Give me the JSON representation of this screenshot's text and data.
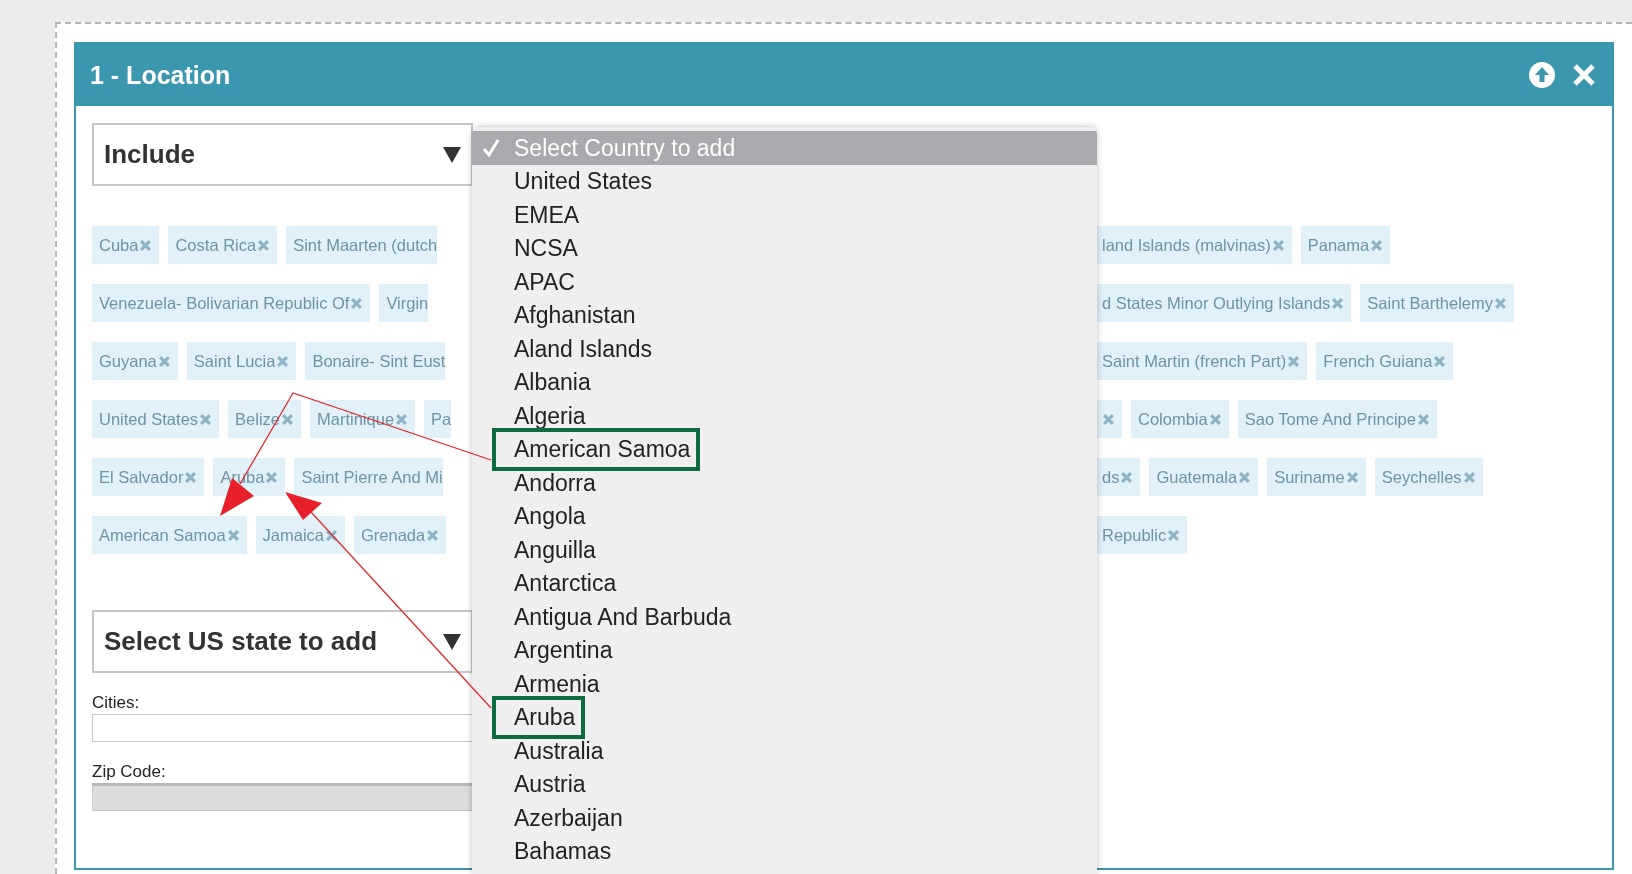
{
  "panel": {
    "title": "1 - Location"
  },
  "mode_select": {
    "value": "Include"
  },
  "tag_rows": [
    {
      "left": [
        {
          "label": "Cuba",
          "close": true
        },
        {
          "label": "Costa Rica",
          "close": true
        },
        {
          "label": "Sint Maarten (dutch",
          "close": false
        }
      ],
      "right": [
        {
          "label": "land Islands (malvinas)",
          "close": true
        },
        {
          "label": "Panama",
          "close": true
        }
      ]
    },
    {
      "left": [
        {
          "label": "Venezuela- Bolivarian Republic Of",
          "close": true
        },
        {
          "label": "Virgin",
          "close": false
        }
      ],
      "right": [
        {
          "label": "d States Minor Outlying Islands",
          "close": true
        },
        {
          "label": "Saint Barthelemy",
          "close": true
        }
      ]
    },
    {
      "left": [
        {
          "label": "Guyana",
          "close": true
        },
        {
          "label": "Saint Lucia",
          "close": true
        },
        {
          "label": "Bonaire- Sint Eust",
          "close": false
        }
      ],
      "right": [
        {
          "label": "Saint Martin (french Part)",
          "close": true
        },
        {
          "label": "French Guiana",
          "close": true
        }
      ]
    },
    {
      "left": [
        {
          "label": "United States",
          "close": true
        },
        {
          "label": "Belize",
          "close": true
        },
        {
          "label": "Martinique",
          "close": true
        },
        {
          "label": "Pa",
          "close": false
        }
      ],
      "right": [
        {
          "close": true
        },
        {
          "label": "Colombia",
          "close": true
        },
        {
          "label": "Sao Tome And Principe",
          "close": true
        }
      ]
    },
    {
      "left": [
        {
          "label": "El Salvador",
          "close": true
        },
        {
          "label": "Aruba",
          "close": true
        },
        {
          "label": "Saint Pierre And Mi",
          "close": false
        }
      ],
      "right": [
        {
          "label": "ds",
          "close": true
        },
        {
          "label": "Guatemala",
          "close": true
        },
        {
          "label": "Suriname",
          "close": true
        },
        {
          "label": "Seychelles",
          "close": true
        }
      ]
    },
    {
      "left": [
        {
          "label": "American Samoa",
          "close": true
        },
        {
          "label": "Jamaica",
          "close": true
        },
        {
          "label": "Grenada",
          "close": true
        }
      ],
      "right": [
        {
          "label": "Republic",
          "close": true
        }
      ]
    }
  ],
  "state_select": {
    "value": "Select US state to add"
  },
  "cities": {
    "label": "Cities:"
  },
  "zip": {
    "label": "Zip Code:",
    "disabled": true
  },
  "country_menu": {
    "items": [
      {
        "label": "Select Country to add",
        "selected": true,
        "boxed": false
      },
      {
        "label": "United States",
        "selected": false,
        "boxed": false
      },
      {
        "label": "EMEA",
        "selected": false,
        "boxed": false
      },
      {
        "label": "NCSA",
        "selected": false,
        "boxed": false
      },
      {
        "label": "APAC",
        "selected": false,
        "boxed": false
      },
      {
        "label": "Afghanistan",
        "selected": false,
        "boxed": false
      },
      {
        "label": "Aland Islands",
        "selected": false,
        "boxed": false
      },
      {
        "label": "Albania",
        "selected": false,
        "boxed": false
      },
      {
        "label": "Algeria",
        "selected": false,
        "boxed": false
      },
      {
        "label": "American Samoa",
        "selected": false,
        "boxed": true
      },
      {
        "label": "Andorra",
        "selected": false,
        "boxed": false
      },
      {
        "label": "Angola",
        "selected": false,
        "boxed": false
      },
      {
        "label": "Anguilla",
        "selected": false,
        "boxed": false
      },
      {
        "label": "Antarctica",
        "selected": false,
        "boxed": false
      },
      {
        "label": "Antigua And Barbuda",
        "selected": false,
        "boxed": false
      },
      {
        "label": "Argentina",
        "selected": false,
        "boxed": false
      },
      {
        "label": "Armenia",
        "selected": false,
        "boxed": false
      },
      {
        "label": "Aruba",
        "selected": false,
        "boxed": true
      },
      {
        "label": "Australia",
        "selected": false,
        "boxed": false
      },
      {
        "label": "Austria",
        "selected": false,
        "boxed": false
      },
      {
        "label": "Azerbaijan",
        "selected": false,
        "boxed": false
      },
      {
        "label": "Bahamas",
        "selected": false,
        "boxed": false
      }
    ]
  }
}
